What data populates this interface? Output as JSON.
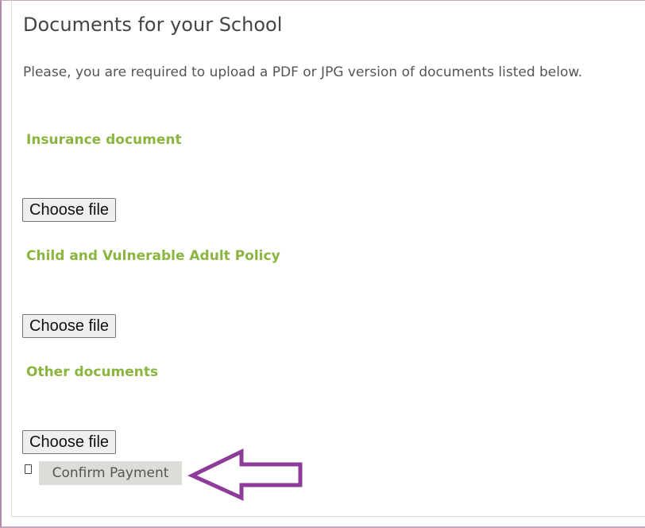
{
  "page": {
    "title": "Documents for your School",
    "intro": "Please, you are required to upload a PDF or JPG version of documents listed below."
  },
  "sections": [
    {
      "label": "Insurance document",
      "button": "Choose file"
    },
    {
      "label": "Child and Vulnerable Adult Policy",
      "button": "Choose file"
    },
    {
      "label": "Other documents",
      "button": "Choose file"
    }
  ],
  "confirm": {
    "label": "Confirm Payment",
    "checked": false
  },
  "colors": {
    "section_label": "#8ab53f",
    "arrow": "#8e3c9a",
    "frame": "#b58aa8"
  },
  "icons": {
    "annotation": "left-arrow-icon"
  }
}
